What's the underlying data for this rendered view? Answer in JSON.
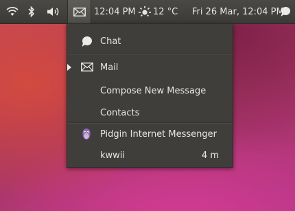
{
  "panel": {
    "icons": [
      "wifi-icon",
      "bluetooth-icon",
      "volume-icon",
      "envelope-icon",
      "weather-sun-icon",
      "user-chat-icon"
    ],
    "clock": "12:04 PM",
    "temperature": "12 °C",
    "datetime": "Fri 26 Mar, 12:04 PM"
  },
  "menu": {
    "chat_label": "Chat",
    "mail_label": "Mail",
    "compose_label": "Compose New Message",
    "contacts_label": "Contacts",
    "pidgin_label": "Pidgin Internet Messenger",
    "kwwii_label": "kwwii",
    "kwwii_time": "4 m"
  },
  "colors": {
    "panel": "#3b3a36",
    "menu": "#3f3e3b",
    "text": "#e8e6e1"
  }
}
